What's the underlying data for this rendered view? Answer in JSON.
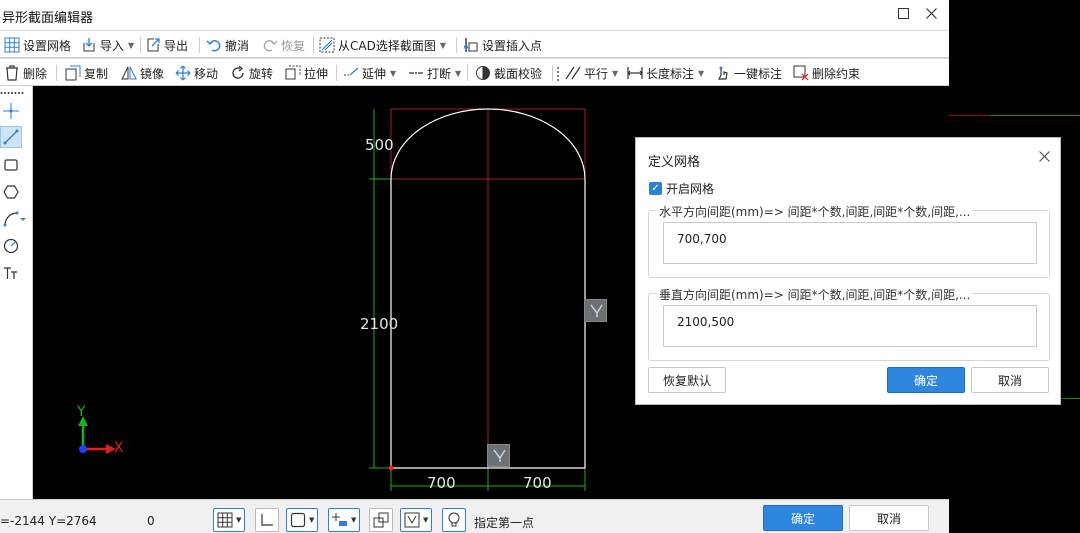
{
  "window": {
    "title": "异形截面编辑器"
  },
  "toolbar1": [
    {
      "key": "grid",
      "label": "设置网格",
      "icon": "grid-icon"
    },
    {
      "key": "import",
      "label": "导入",
      "icon": "import-icon",
      "caret": true
    },
    {
      "key": "export",
      "label": "导出",
      "icon": "export-icon"
    },
    {
      "key": "undo",
      "label": "撤消",
      "icon": "undo-icon"
    },
    {
      "key": "redo",
      "label": "恢复",
      "icon": "redo-icon",
      "disabled": true
    },
    {
      "key": "cad",
      "label": "从CAD选择截面图",
      "icon": "cad-select-icon",
      "caret": true
    },
    {
      "key": "insert",
      "label": "设置插入点",
      "icon": "insert-point-icon"
    }
  ],
  "toolbar2": [
    {
      "key": "delete",
      "label": "删除",
      "icon": "trash-icon"
    },
    {
      "key": "copy",
      "label": "复制",
      "icon": "copy-icon"
    },
    {
      "key": "mirror",
      "label": "镜像",
      "icon": "mirror-icon"
    },
    {
      "key": "move",
      "label": "移动",
      "icon": "move-icon"
    },
    {
      "key": "rotate",
      "label": "旋转",
      "icon": "rotate-icon"
    },
    {
      "key": "stretch",
      "label": "拉伸",
      "icon": "stretch-icon"
    },
    {
      "key": "extend",
      "label": "延伸",
      "icon": "extend-icon",
      "caret": true
    },
    {
      "key": "break",
      "label": "打断",
      "icon": "break-icon",
      "caret": true
    },
    {
      "key": "check",
      "label": "截面校验",
      "icon": "section-check-icon"
    },
    {
      "key": "parallel",
      "label": "平行",
      "icon": "parallel-icon",
      "caret": true
    },
    {
      "key": "length",
      "label": "长度标注",
      "icon": "length-dimension-icon",
      "caret": true
    },
    {
      "key": "auto",
      "label": "一键标注",
      "icon": "auto-dimension-icon"
    },
    {
      "key": "delcon",
      "label": "删除约束",
      "icon": "delete-constraint-icon"
    }
  ],
  "palette": [
    {
      "key": "point",
      "icon": "point-icon"
    },
    {
      "key": "line",
      "icon": "line-icon",
      "active": true
    },
    {
      "key": "rect",
      "icon": "rectangle-icon"
    },
    {
      "key": "polygon",
      "icon": "polygon-icon"
    },
    {
      "key": "arc",
      "icon": "arc-icon"
    },
    {
      "key": "circle",
      "icon": "circle-icon"
    },
    {
      "key": "text",
      "icon": "text-icon"
    }
  ],
  "canvas": {
    "dimensions": {
      "arc_height": "500",
      "wall_height": "2100",
      "left_width": "700",
      "right_width": "700"
    },
    "axes": {
      "x_label": "X",
      "y_label": "Y"
    }
  },
  "status": {
    "coords": "=-2144 Y=2764",
    "value": "0",
    "hint": "指定第一点",
    "ok_label": "确定",
    "cancel_label": "取消"
  },
  "dialog": {
    "title": "定义网格",
    "checkbox_label": "开启网格",
    "checkbox_checked": true,
    "horizontal_label": "水平方向间距(mm)=> 间距*个数,间距,间距*个数,间距,...",
    "horizontal_value": "700,700",
    "vertical_label": "垂直方向间距(mm)=> 间距*个数,间距,间距*个数,间距,...",
    "vertical_value": "2100,500",
    "restore_label": "恢复默认",
    "ok_label": "确定",
    "cancel_label": "取消"
  },
  "colors": {
    "accent": "#2e86de",
    "grid_line": "#a02020",
    "dim_line": "#1db01d",
    "shape": "#ffffff"
  }
}
